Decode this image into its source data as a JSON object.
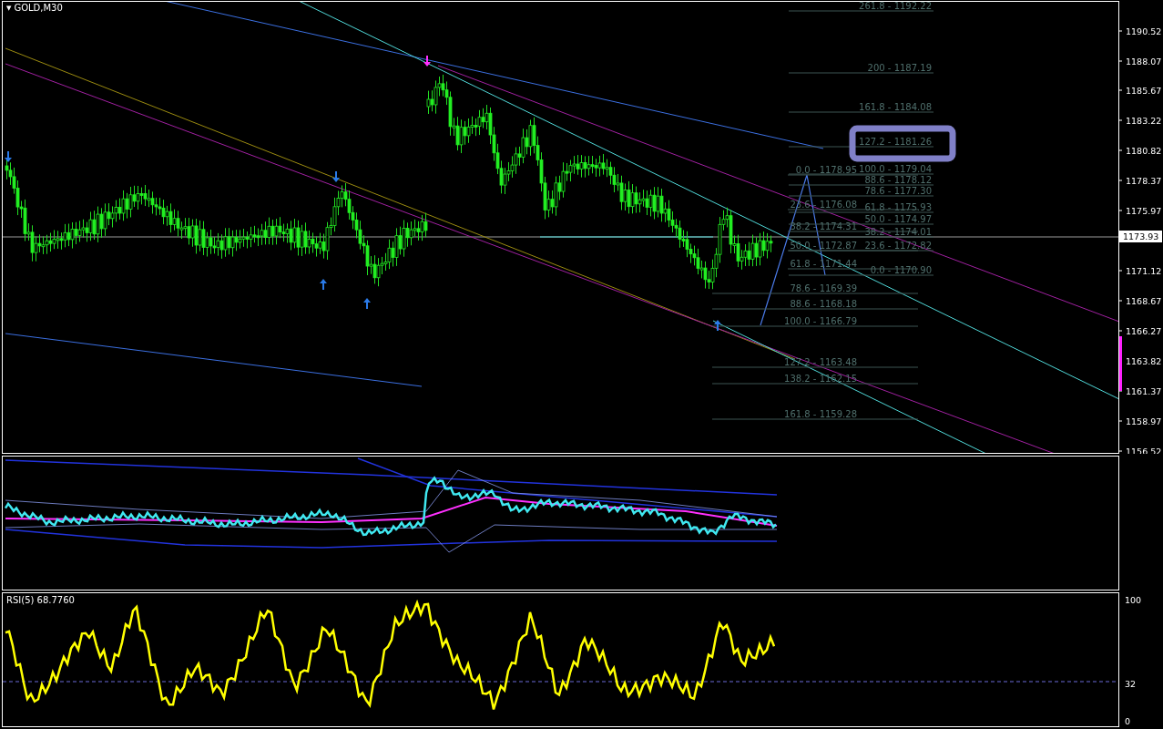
{
  "chart": {
    "title": "GOLD,M30",
    "menu_glyph": "▼"
  },
  "price_axis": [
    "1190.52",
    "1188.07",
    "1185.67",
    "1183.22",
    "1180.82",
    "1178.37",
    "1175.97",
    "1171.12",
    "1168.67",
    "1166.27",
    "1163.82",
    "1161.37",
    "1158.97",
    "1156.52"
  ],
  "current_price": "1173.93",
  "fibo_left": [
    "0.0 - 1178.95",
    "23.6 - 1176.08",
    "38.2 - 1174.31",
    "50.0 - 1172.87",
    "61.8 - 1171.44",
    "78.6 - 1169.39",
    "88.6 - 1168.18",
    "100.0 - 1166.79",
    "127.2 - 1163.48",
    "138.2 - 1162.15",
    "161.8 - 1159.28"
  ],
  "fibo_right": [
    "261.8 - 1192.22",
    "200 - 1187.19",
    "161.8 - 1184.08",
    "127.2 - 1181.26",
    "100.0 - 1179.04",
    "88.6 - 1178.12",
    "78.6 - 1177.30",
    "61.8 - 1175.93",
    "50.0 - 1174.97",
    "38.2 - 1174.01",
    "23.6 - 1172.82",
    "0.0 - 1170.90"
  ],
  "rsi": {
    "label": "RSI(5) 68.7760",
    "axis": [
      "100",
      "32",
      "0"
    ]
  }
}
